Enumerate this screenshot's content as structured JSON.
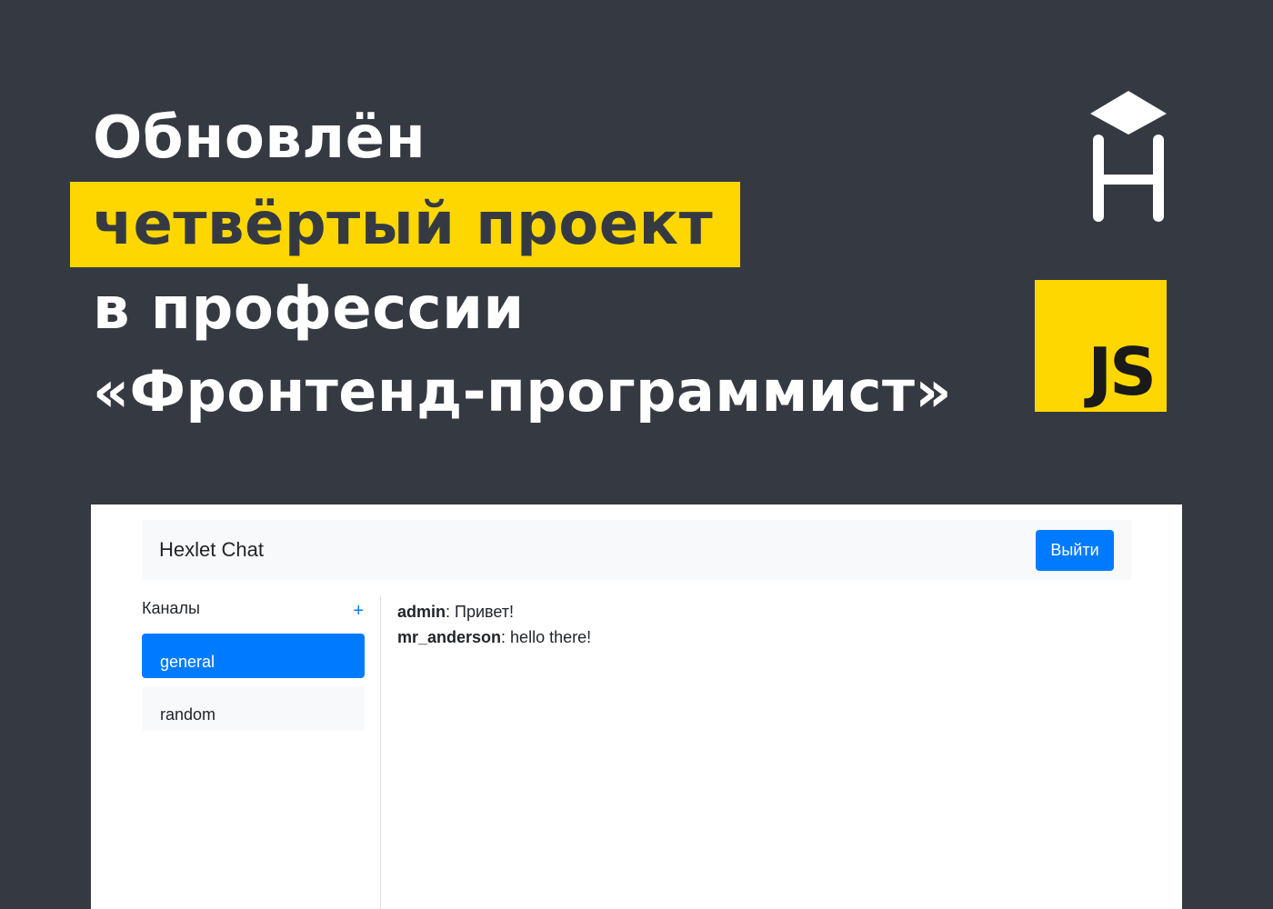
{
  "headline": {
    "line1": "Обновлён",
    "line2": "четвёртый проект",
    "line3": "в профессии",
    "line4": "«Фронтенд-программист»"
  },
  "badge": {
    "js": "JS"
  },
  "colors": {
    "background": "#353a42",
    "accent": "#ffd700",
    "primary": "#007bff",
    "white": "#ffffff"
  },
  "icons": {
    "logo": "hexlet-logo-icon"
  },
  "app": {
    "brand": "Hexlet Chat",
    "logout_label": "Выйти",
    "sidebar": {
      "title": "Каналы",
      "add_label": "+",
      "channels": [
        {
          "label": "general",
          "active": true
        },
        {
          "label": "random",
          "active": false
        }
      ]
    },
    "messages": [
      {
        "author": "admin",
        "text": ": Привет!"
      },
      {
        "author": "mr_anderson",
        "text": ": hello there!"
      }
    ]
  }
}
